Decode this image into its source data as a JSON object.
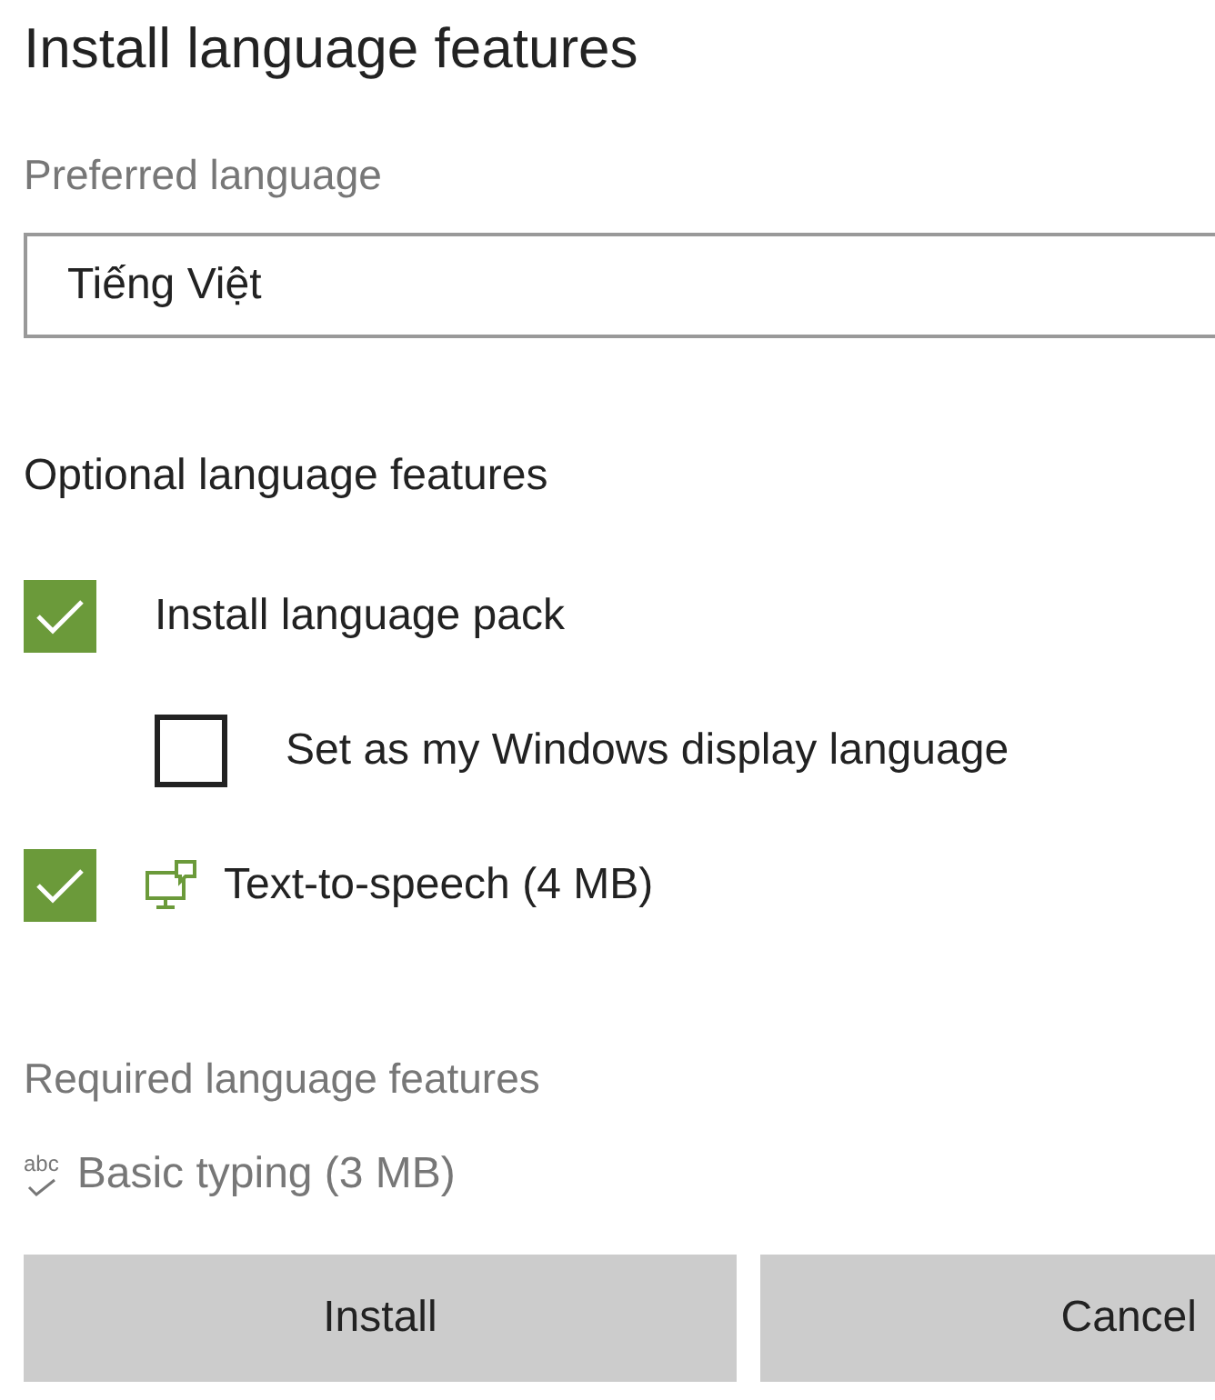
{
  "title": "Install language features",
  "preferred_language": {
    "label": "Preferred language",
    "value": "Tiếng Việt"
  },
  "optional": {
    "heading": "Optional language features",
    "items": [
      {
        "label": "Install language pack",
        "checked": true,
        "children": [
          {
            "label": "Set as my Windows display language",
            "checked": false
          }
        ]
      },
      {
        "label": "Text-to-speech (4 MB)",
        "checked": true,
        "kind": "speech"
      }
    ]
  },
  "required": {
    "heading": "Required language features",
    "items": [
      {
        "label": "Basic typing (3 MB)",
        "icon_text": "abc"
      }
    ]
  },
  "buttons": [
    {
      "label": "Install",
      "kind": "primary"
    },
    {
      "label": "Cancel",
      "kind": "secondary"
    }
  ]
}
